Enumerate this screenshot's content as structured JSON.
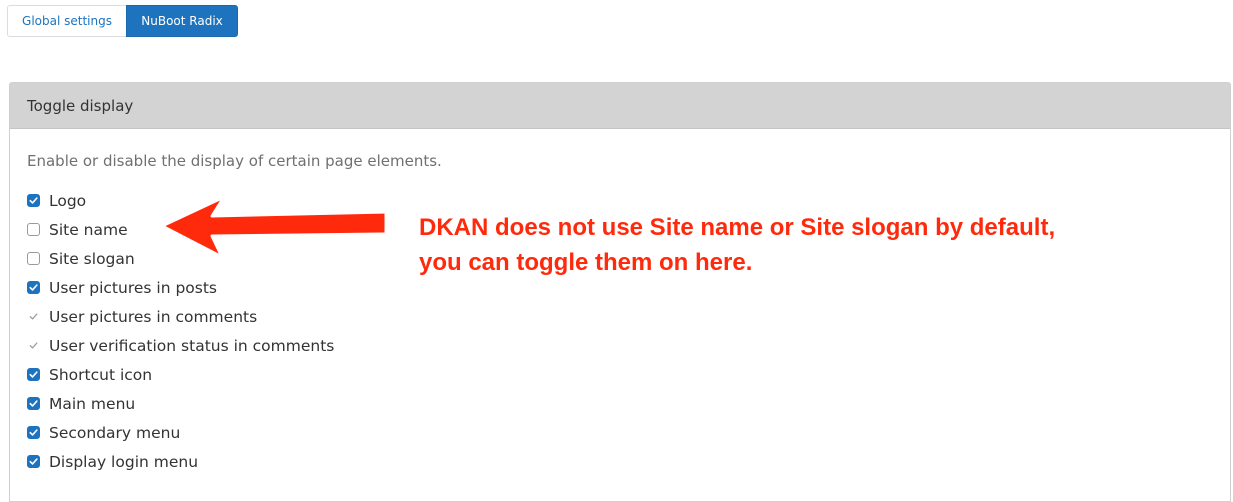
{
  "tabs": [
    {
      "label": "Global settings",
      "active": false
    },
    {
      "label": "NuBoot Radix",
      "active": true
    }
  ],
  "toggle_display": {
    "legend": "Toggle display",
    "description": "Enable or disable the display of certain page elements.",
    "options": [
      {
        "label": "Logo",
        "state": "checked"
      },
      {
        "label": "Site name",
        "state": "unchecked"
      },
      {
        "label": "Site slogan",
        "state": "unchecked"
      },
      {
        "label": "User pictures in posts",
        "state": "checked"
      },
      {
        "label": "User pictures in comments",
        "state": "checked-disabled"
      },
      {
        "label": "User verification status in comments",
        "state": "checked-disabled"
      },
      {
        "label": "Shortcut icon",
        "state": "checked"
      },
      {
        "label": "Main menu",
        "state": "checked"
      },
      {
        "label": "Secondary menu",
        "state": "checked"
      },
      {
        "label": "Display login menu",
        "state": "checked"
      }
    ]
  },
  "annotation": {
    "line1": "DKAN does not use Site name or Site slogan by default,",
    "line2": "you can toggle them on here."
  },
  "colors": {
    "accent": "#1e73be",
    "annotation": "#ff2a0c",
    "legend_bg": "#d3d3d3"
  }
}
